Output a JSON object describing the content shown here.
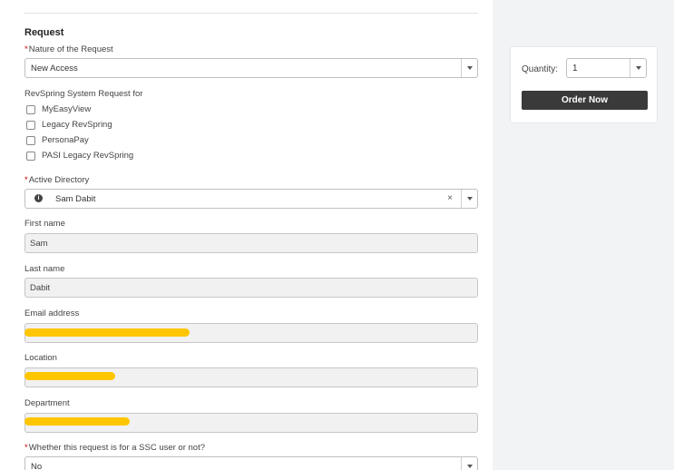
{
  "form": {
    "section_title": "Request",
    "nature": {
      "label": "Nature of the Request",
      "value": "New Access"
    },
    "revspring": {
      "label": "RevSpring System Request for",
      "options": [
        "MyEasyView",
        "Legacy RevSpring",
        "PersonaPay",
        "PASI Legacy RevSpring"
      ]
    },
    "active_directory": {
      "label": "Active Directory",
      "value": "Sam Dabit",
      "clear": "×"
    },
    "first_name": {
      "label": "First name",
      "value": "Sam"
    },
    "last_name": {
      "label": "Last name",
      "value": "Dabit"
    },
    "email": {
      "label": "Email address"
    },
    "location": {
      "label": "Location"
    },
    "department": {
      "label": "Department"
    },
    "ssc": {
      "label": "Whether this request is for a SSC user or not?",
      "value": "No"
    },
    "required_mark": "*"
  },
  "order": {
    "quantity_label": "Quantity:",
    "quantity_value": "1",
    "button_label": "Order Now"
  },
  "colors": {
    "redaction": "#ffc600",
    "button_bg": "#3a3a3a",
    "page_bg": "#f2f3f5"
  },
  "icons": [
    "info-icon",
    "chevron-down-icon",
    "clear-icon"
  ]
}
